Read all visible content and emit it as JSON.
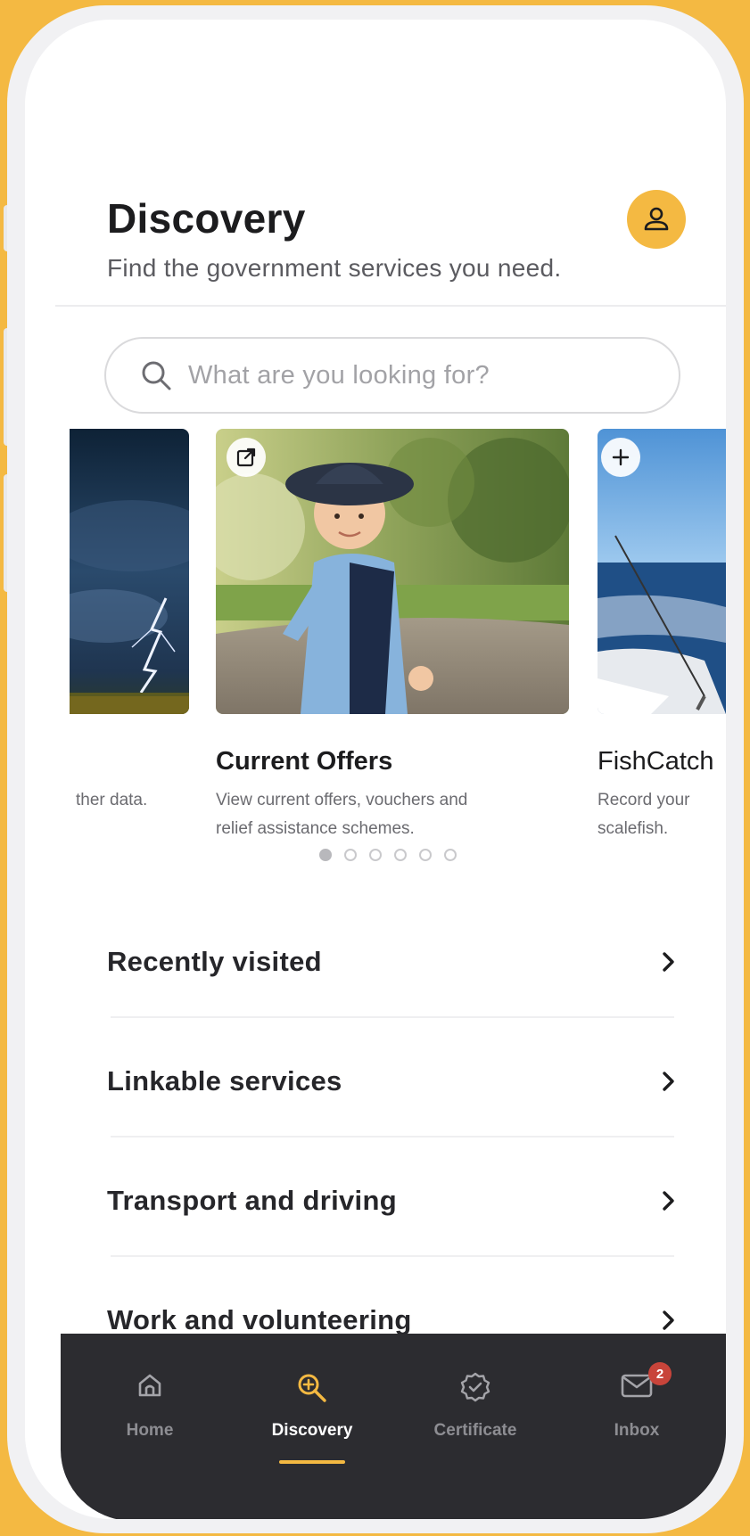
{
  "header": {
    "title": "Discovery",
    "subtitle": "Find the government services you need."
  },
  "search": {
    "placeholder": "What are you looking for?"
  },
  "carousel": {
    "cards": [
      {
        "title": "",
        "description_lines": [
          "ther data."
        ],
        "image": "lightning-storm"
      },
      {
        "title": "Current Offers",
        "description_lines": [
          "View current offers, vouchers and",
          "relief assistance schemes."
        ],
        "image": "child-in-bucket-hat",
        "action_icon": "external-link-icon"
      },
      {
        "title": "FishCatch",
        "description_lines": [
          "Record your",
          "scalefish."
        ],
        "image": "fishing-boat",
        "action_icon": "plus-icon"
      }
    ],
    "page_count": 6,
    "active_page": 0
  },
  "sections": [
    {
      "label": "Recently visited"
    },
    {
      "label": "Linkable services"
    },
    {
      "label": "Transport and driving"
    },
    {
      "label": "Work and volunteering"
    }
  ],
  "tabbar": {
    "tabs": [
      {
        "label": "Home",
        "icon": "home-icon"
      },
      {
        "label": "Discovery",
        "icon": "discovery-search-icon",
        "active": true
      },
      {
        "label": "Certificate",
        "icon": "certificate-icon"
      },
      {
        "label": "Inbox",
        "icon": "mail-icon",
        "badge": "2"
      }
    ]
  },
  "colors": {
    "accent": "#f4b942",
    "tabbar_bg": "#2c2c30",
    "badge": "#c8443a"
  }
}
